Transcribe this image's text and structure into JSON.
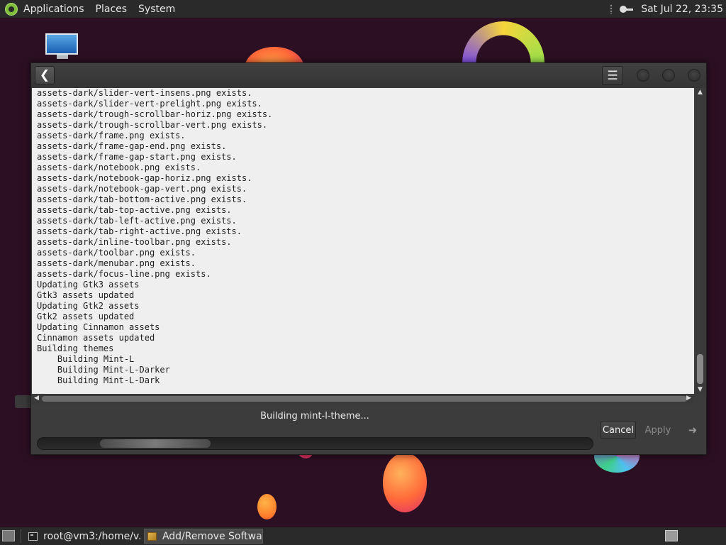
{
  "top_panel": {
    "menus": [
      "Applications",
      "Places",
      "System"
    ],
    "clock": "Sat Jul 22, 23:35"
  },
  "window": {
    "back_icon": "back-arrow-icon",
    "menu_icon": "hamburger-menu-icon",
    "output_lines": [
      "assets-dark/slider-vert-insens.png exists.",
      "assets-dark/slider-vert-prelight.png exists.",
      "assets-dark/trough-scrollbar-horiz.png exists.",
      "assets-dark/trough-scrollbar-vert.png exists.",
      "assets-dark/frame.png exists.",
      "assets-dark/frame-gap-end.png exists.",
      "assets-dark/frame-gap-start.png exists.",
      "assets-dark/notebook.png exists.",
      "assets-dark/notebook-gap-horiz.png exists.",
      "assets-dark/notebook-gap-vert.png exists.",
      "assets-dark/tab-bottom-active.png exists.",
      "assets-dark/tab-top-active.png exists.",
      "assets-dark/tab-left-active.png exists.",
      "assets-dark/tab-right-active.png exists.",
      "assets-dark/inline-toolbar.png exists.",
      "assets-dark/toolbar.png exists.",
      "assets-dark/menubar.png exists.",
      "assets-dark/focus-line.png exists.",
      "Updating Gtk3 assets",
      "Gtk3 assets updated",
      "Updating Gtk2 assets",
      "Gtk2 assets updated",
      "Updating Cinnamon assets",
      "Cinnamon assets updated",
      "Building themes",
      "    Building Mint-L",
      "    Building Mint-L-Darker",
      "    Building Mint-L-Dark"
    ],
    "status": "Building mint-l-theme...",
    "cancel_label": "Cancel",
    "apply_label": "Apply"
  },
  "bottom_panel": {
    "tasks": [
      {
        "label": "root@vm3:/home/v...",
        "icon": "terminal-icon",
        "active": false
      },
      {
        "label": "Add/Remove Software",
        "icon": "package-icon",
        "active": true
      }
    ]
  }
}
